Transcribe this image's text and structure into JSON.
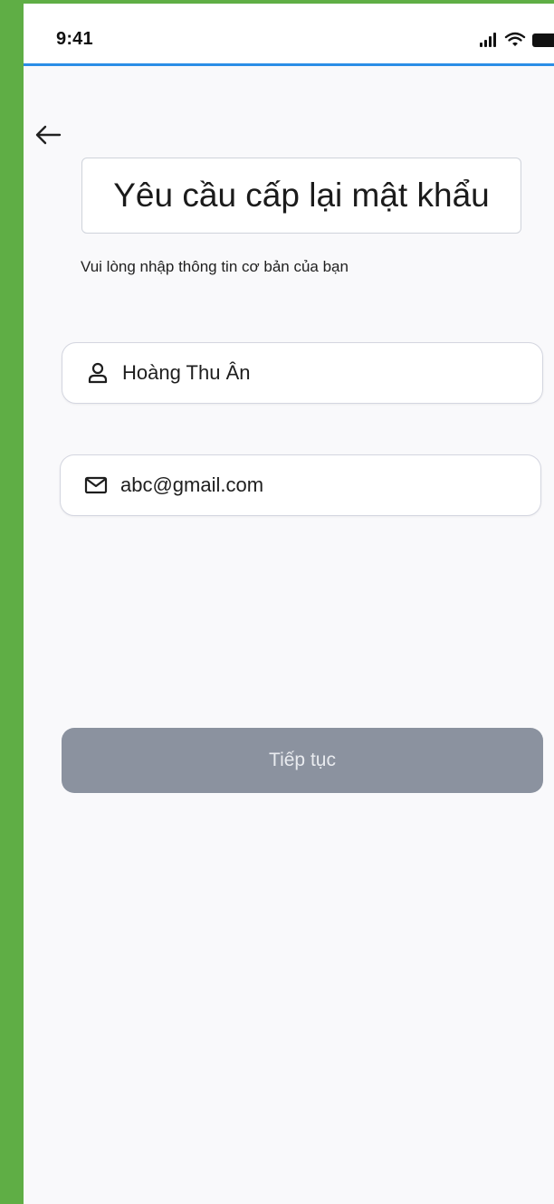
{
  "status_bar": {
    "time": "9:41",
    "icons": [
      "signal-icon",
      "wifi-icon",
      "battery-icon"
    ]
  },
  "header": {
    "back_icon": "arrow-left-icon",
    "title": "Yêu cầu cấp lại mật khẩu",
    "subtitle": "Vui lòng nhập thông tin cơ bản của bạn"
  },
  "form": {
    "name_field": {
      "icon": "user-icon",
      "value": "Hoàng Thu Ân"
    },
    "email_field": {
      "icon": "mail-icon",
      "value": "abc@gmail.com"
    },
    "submit_label": "Tiếp tục"
  },
  "colors": {
    "frame_background": "#5fae45",
    "status_accent": "#2b8ee6",
    "button_disabled": "#8b929f"
  }
}
